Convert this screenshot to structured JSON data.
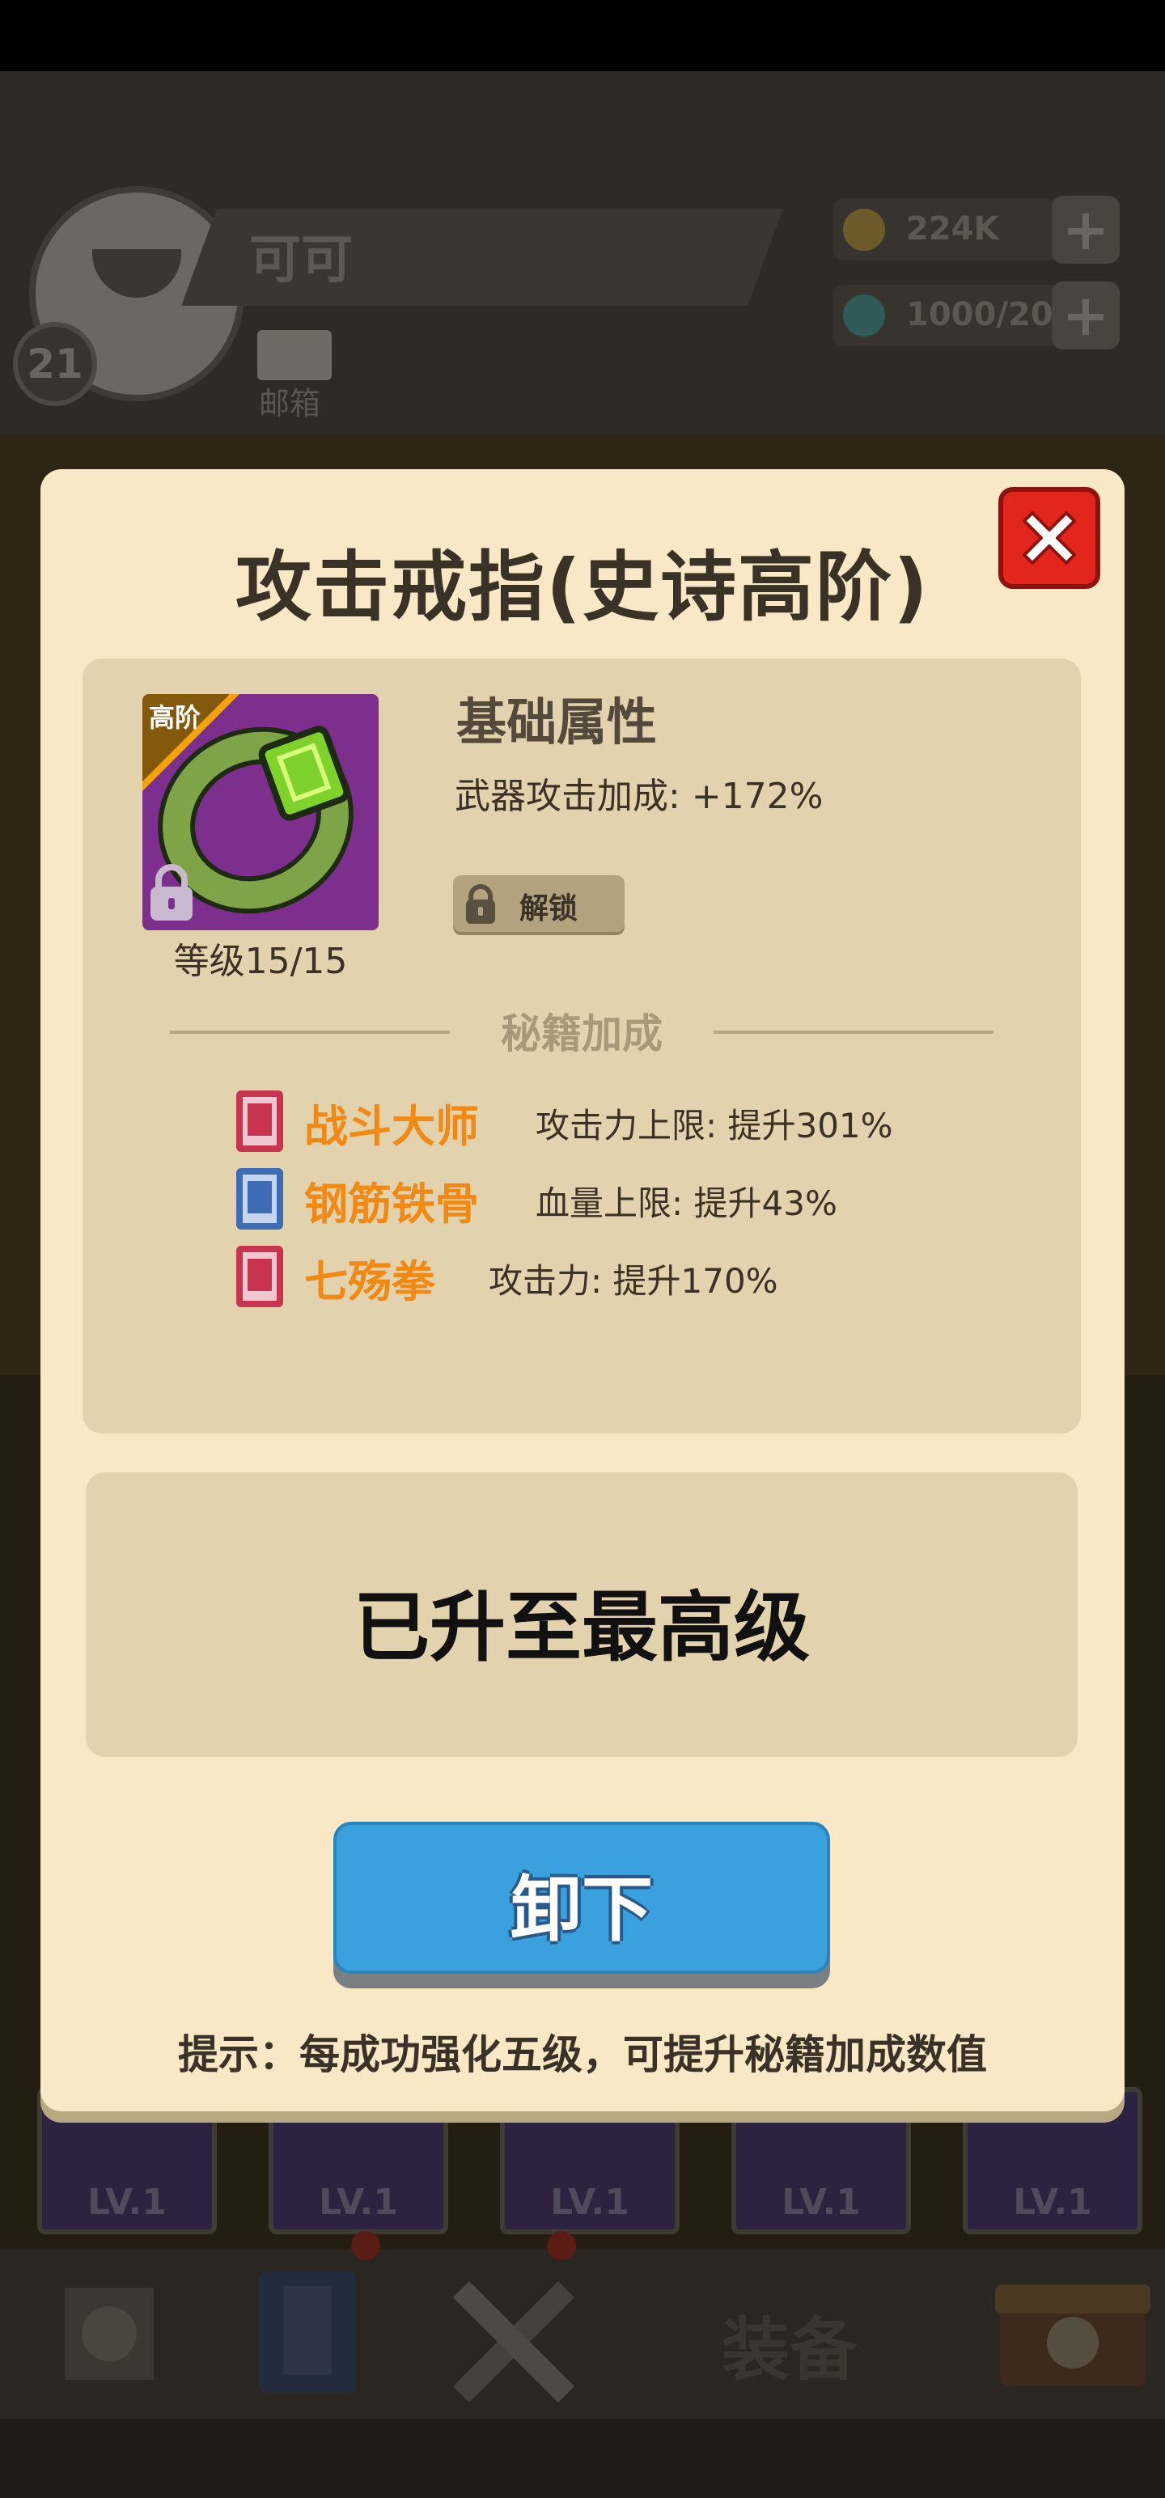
{
  "background": {
    "player_name": "可可",
    "player_level": "21",
    "mail_label": "邮箱",
    "gold": "224K",
    "energy": "1000/20",
    "slots": [
      "LV.1",
      "LV.1",
      "LV.1",
      "LV.1",
      "LV.1"
    ],
    "nav_equip_label": "装备"
  },
  "modal": {
    "title": "攻击戒指(史诗高阶)",
    "item": {
      "tier_badge": "高阶",
      "level": "等级15/15"
    },
    "attributes": {
      "title": "基础属性",
      "line": "武器攻击加成: +172%",
      "unlock_label": "解锁"
    },
    "secret_section_title": "秘籍加成",
    "books": [
      {
        "name": "战斗大师",
        "effect": "攻击力上限: 提升301%",
        "color": "#c8334f"
      },
      {
        "name": "钢筋铁骨",
        "effect": "血量上限: 提升43%",
        "color": "#3e6db5"
      },
      {
        "name": "七殇拳",
        "effect": "攻击力: 提升170%",
        "color": "#c8334f"
      }
    ],
    "max_level_text": "已升至最高级",
    "unequip_label": "卸下",
    "hint": "提示：每成功强化五级，可提升秘籍加成数值"
  },
  "colors": {
    "modal_bg": "#f8e8c6",
    "panel_bg": "#e2d2ad",
    "accent_orange": "#f08a15",
    "button_blue": "#3aa0de",
    "close_red": "#e2261e"
  }
}
